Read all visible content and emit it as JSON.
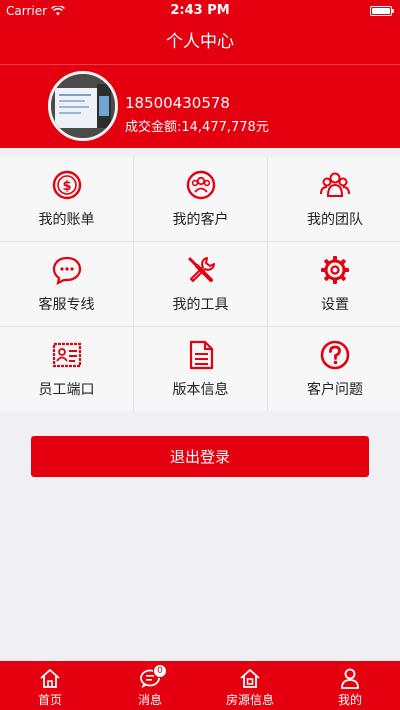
{
  "status_bar": {
    "carrier": "Carrier",
    "time": "2:43 PM"
  },
  "nav": {
    "title": "个人中心"
  },
  "profile": {
    "phone": "18500430578",
    "amount": "成交金额:14,477,778元"
  },
  "menu": [
    {
      "label": "我的账单",
      "icon": "dollar-circle-icon"
    },
    {
      "label": "我的客户",
      "icon": "customers-circle-icon"
    },
    {
      "label": "我的团队",
      "icon": "team-icon"
    },
    {
      "label": "客服专线",
      "icon": "chat-bubble-icon"
    },
    {
      "label": "我的工具",
      "icon": "tools-icon"
    },
    {
      "label": "设置",
      "icon": "gear-icon"
    },
    {
      "label": "员工端口",
      "icon": "id-card-icon"
    },
    {
      "label": "版本信息",
      "icon": "document-icon"
    },
    {
      "label": "客户问题",
      "icon": "question-circle-icon"
    }
  ],
  "logout_label": "退出登录",
  "tabs": [
    {
      "label": "首页",
      "icon": "home-icon"
    },
    {
      "label": "消息",
      "icon": "message-icon",
      "badge": "0"
    },
    {
      "label": "房源信息",
      "icon": "house-icon"
    },
    {
      "label": "我的",
      "icon": "user-icon"
    }
  ],
  "colors": {
    "brand": "#e4000f",
    "background": "#efeff4",
    "cell": "#f7f7f7"
  }
}
